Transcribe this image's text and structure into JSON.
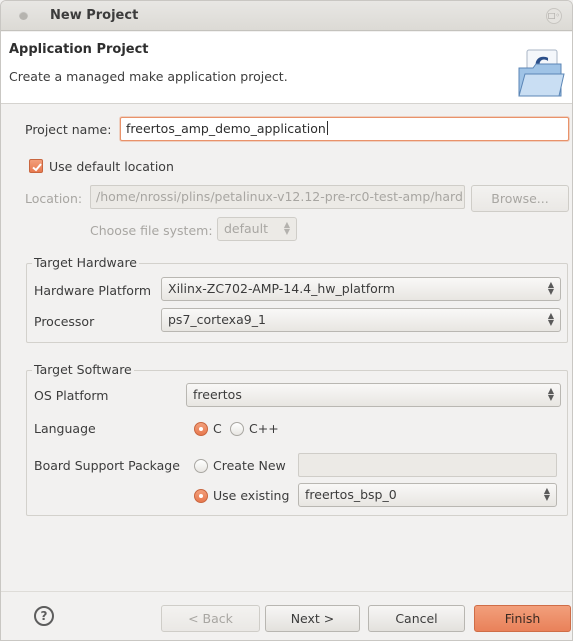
{
  "window": {
    "title": "New Project",
    "restore_glyph": "□◦"
  },
  "banner": {
    "title": "Application Project",
    "description": "Create a managed make application project.",
    "icon": "folder-c-wizard-icon"
  },
  "project": {
    "name_label": "Project name:",
    "name_value": "freertos_amp_demo_application"
  },
  "location": {
    "use_default_label": "Use default location",
    "use_default_checked": true,
    "location_label": "Location:",
    "location_value": "/home/nrossi/plins/petalinux-v12.12-pre-rc0-test-amp/hard",
    "browse_label": "Browse...",
    "filesystem_label": "Choose file system:",
    "filesystem_value": "default"
  },
  "target_hardware": {
    "title": "Target Hardware",
    "platform_label": "Hardware Platform",
    "platform_value": "Xilinx-ZC702-AMP-14.4_hw_platform",
    "processor_label": "Processor",
    "processor_value": "ps7_cortexa9_1"
  },
  "target_software": {
    "title": "Target Software",
    "os_label": "OS Platform",
    "os_value": "freertos",
    "language_label": "Language",
    "language_options": [
      "C",
      "C++"
    ],
    "language_selected": "C",
    "bsp_label": "Board Support Package",
    "create_new_label": "Create New",
    "create_new_value": "",
    "use_existing_label": "Use existing",
    "use_existing_value": "freertos_bsp_0"
  },
  "footer": {
    "help": "?",
    "back": "< Back",
    "next": "Next >",
    "cancel": "Cancel",
    "finish": "Finish"
  },
  "colors": {
    "accent": "#e9815a",
    "focus": "#e9926a",
    "window_bg": "#f2f1f0"
  }
}
